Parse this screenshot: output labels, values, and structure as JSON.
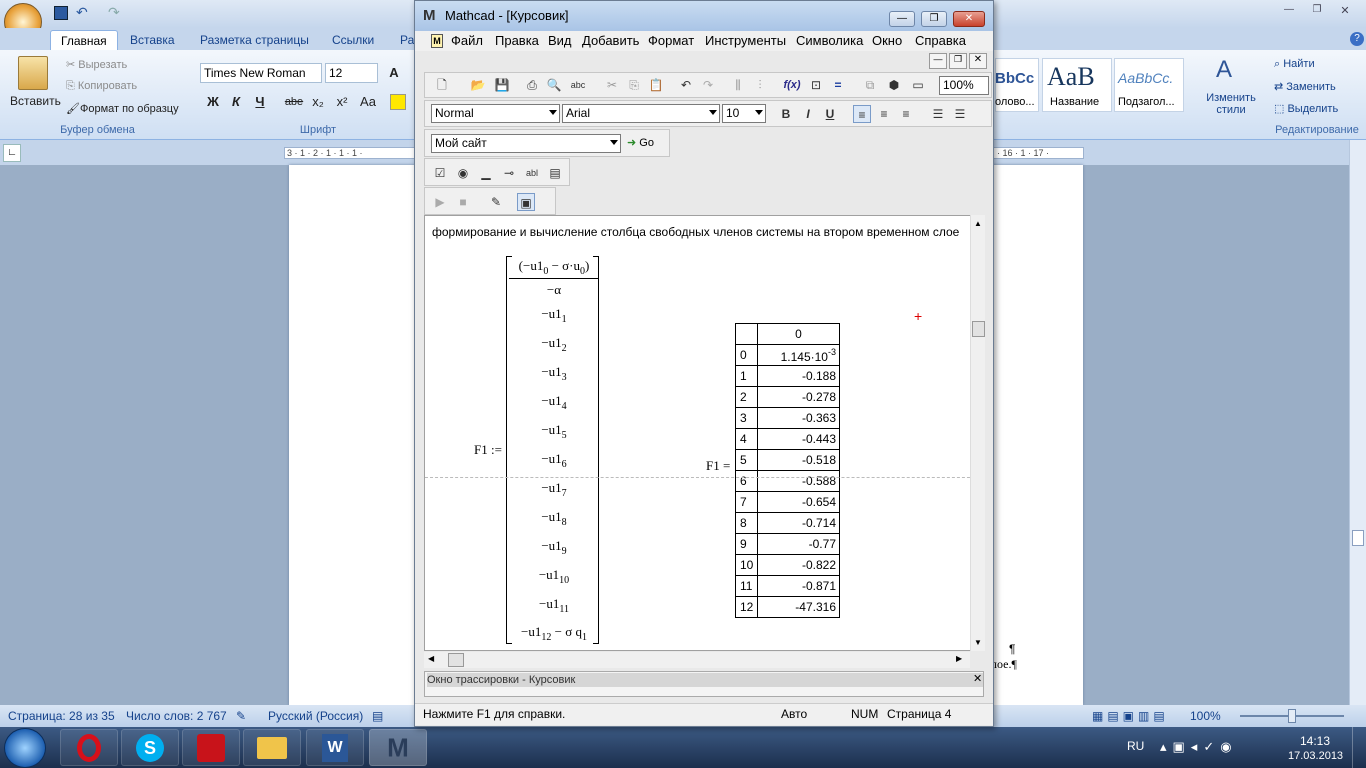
{
  "word": {
    "tabs": [
      "Главная",
      "Вставка",
      "Разметка страницы",
      "Ссылки",
      "Ра"
    ],
    "clipboard": {
      "paste": "Вставить",
      "cut": "Вырезать",
      "copy": "Копировать",
      "format_painter": "Формат по образцу",
      "group": "Буфер обмена"
    },
    "font": {
      "name": "Times New Roman",
      "size": "12",
      "group": "Шрифт",
      "bold": "Ж",
      "italic": "К",
      "underline": "Ч",
      "strike": "abe",
      "sub": "x₂",
      "sup": "x²",
      "case": "Aa"
    },
    "styles": {
      "style1_preview": "BbCc",
      "style1_label": "олово...",
      "style2_preview": "AaB",
      "style2_label": "Название",
      "style3_preview": "AaBbCc.",
      "style3_label": "Подзагол...",
      "change_styles": "Изменить стили"
    },
    "editing": {
      "find": "Найти",
      "replace": "Заменить",
      "select": "Выделить",
      "group": "Редактирование"
    },
    "ruler_left": "3 · 1 · 2 · 1 · 1 · 1 ·",
    "ruler_right": "· 16 · 1 · 17 ·",
    "side_text": "лое.¶",
    "pilcrow": "¶",
    "status": {
      "page": "Страница: 28 из 35",
      "words": "Число слов: 2 767",
      "lang": "Русский (Россия)",
      "zoom": "100%"
    }
  },
  "mathcad": {
    "title": "Mathcad - [Курсовик]",
    "menu": [
      "Файл",
      "Правка",
      "Вид",
      "Добавить",
      "Формат",
      "Инструменты",
      "Символика",
      "Окно",
      "Справка"
    ],
    "zoom": "100%",
    "style_combo": "Normal",
    "font_combo": "Arial",
    "size_combo": "10",
    "site_combo": "Мой сайт",
    "go_label": "Go",
    "text_region": "формирование и вычисление столбца свободных членов системы на втором временном слое",
    "f1_def": "F1 :=",
    "f1_eval": "F1 =",
    "vector": {
      "first_num": "(−u1",
      "first_mid": " − σ·u",
      "first_den": "−α",
      "rows": [
        {
          "a": "−u1",
          "s": "1"
        },
        {
          "a": "−u1",
          "s": "2"
        },
        {
          "a": "−u1",
          "s": "3"
        },
        {
          "a": "−u1",
          "s": "4"
        },
        {
          "a": "−u1",
          "s": "5"
        },
        {
          "a": "−u1",
          "s": "6"
        },
        {
          "a": "−u1",
          "s": "7"
        },
        {
          "a": "−u1",
          "s": "8"
        },
        {
          "a": "−u1",
          "s": "9"
        },
        {
          "a": "−u1",
          "s": "10"
        },
        {
          "a": "−u1",
          "s": "11"
        }
      ],
      "last_a": "−u1",
      "last_s": "12",
      "last_mid": " − σ q",
      "last_q": "1"
    },
    "result": {
      "header": "0",
      "first_value_base": "1.145·10",
      "first_value_exp": "-3",
      "indices": [
        "0",
        "1",
        "2",
        "3",
        "4",
        "5",
        "6",
        "7",
        "8",
        "9",
        "10",
        "11",
        "12"
      ],
      "values": [
        "",
        "-0.188",
        "-0.278",
        "-0.363",
        "-0.443",
        "-0.518",
        "-0.588",
        "-0.654",
        "-0.714",
        "-0.77",
        "-0.822",
        "-0.871",
        "-47.316"
      ]
    },
    "trace_title": "Окно трассировки - Курсовик",
    "status": {
      "help": "Нажмите F1 для справки.",
      "mode": "Авто",
      "num": "NUM",
      "page": "Страница 4"
    }
  },
  "taskbar": {
    "lang": "RU",
    "time": "14:13",
    "date": "17.03.2013"
  }
}
